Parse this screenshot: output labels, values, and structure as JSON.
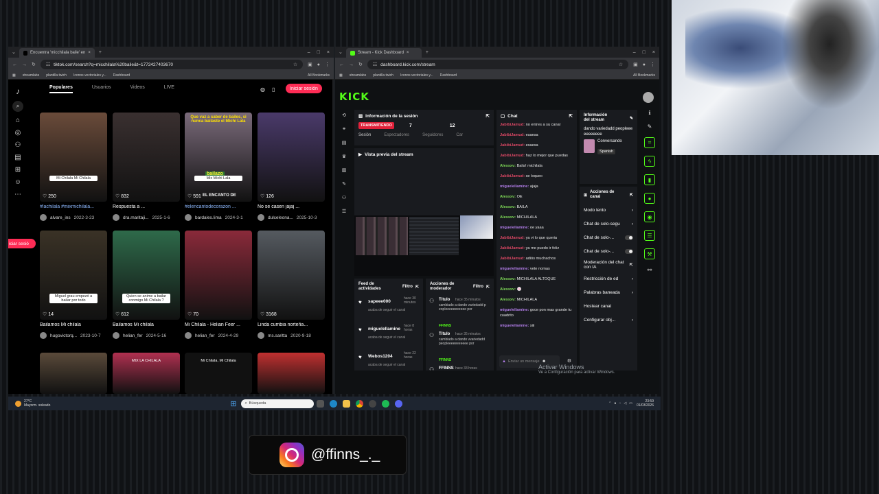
{
  "left_browser": {
    "tab_title": "Encuentra 'micchilala baile' en",
    "url": "tiktok.com/search?q=micchilala%20baile&t=1772427403670",
    "bookmarks": [
      "streamlabs",
      "plantilla twich",
      "Iconos vectoriales y...",
      "Dashboard"
    ],
    "all_bookmarks": "All Bookmarks"
  },
  "tiktok": {
    "tabs": [
      "Populares",
      "Usuarios",
      "Videos",
      "LIVE"
    ],
    "login_button": "Iniciar sesión",
    "side_login": "iciar sesió",
    "videos": [
      {
        "likes": "250",
        "overlay": "Mi Chilala Mi Chilala",
        "caption": "#lachilala #mixmichilala...",
        "user": "alvare_ins",
        "date": "2022-3-23",
        "color": "#6a4b3a"
      },
      {
        "likes": "832",
        "overlay": "",
        "caption": "Respuesta a ...",
        "user": "dra.maritaji...",
        "date": "2025-1-6",
        "color": "#3a3030"
      },
      {
        "likes": "591",
        "overlay": "Mix Michi Lala",
        "caption": "#elencantodecorazon ...",
        "user": "bardales.lima",
        "date": "2024-3-1",
        "color": "#7a6a7a",
        "top_text": "Que vaz a saber de bailes, si nunca bailaste el Michi Lala",
        "mid_text": "bailazo",
        "low_text": "EL ENCANTO DE"
      },
      {
        "likes": "126",
        "overlay": "",
        "caption": "No se casen jajaj ...",
        "user": "dulceleona...",
        "date": "2025-10-3",
        "color": "#4a3a6a"
      },
      {
        "likes": "14",
        "overlay": "Miguel grau empezó a bailar por todo",
        "caption": "Bailamos Mi chilala",
        "user": "hugovictorq...",
        "date": "2023-10-7",
        "color": "#3a3226"
      },
      {
        "likes": "612",
        "overlay": "Quien se anime a bailar conmigo Mi Chilala ?",
        "caption": "Bailamos Mi chilala",
        "user": "helian_fer",
        "date": "2024-5-16",
        "color": "#2e6a4a"
      },
      {
        "likes": "70",
        "overlay": "",
        "caption": "Mi Chilala - Helian Feer ...",
        "user": "helian_fer",
        "date": "2024-4-29",
        "color": "#8a2a3a"
      },
      {
        "likes": "3168",
        "overlay": "",
        "caption": "Linda cumbia norteña...",
        "user": "ms.saritta",
        "date": "2020-9-18",
        "color": "#555a60"
      },
      {
        "likes": "",
        "overlay": "",
        "caption": "",
        "user": "",
        "date": "",
        "color": "#5a4a3a"
      },
      {
        "likes": "",
        "overlay": "MIX LA CHILALA",
        "caption": "",
        "user": "",
        "date": "",
        "color": "#b03050"
      },
      {
        "likes": "",
        "overlay": "Mi Chilala, Mi Chilala",
        "caption": "",
        "user": "",
        "date": "",
        "color": "#111"
      },
      {
        "likes": "",
        "overlay": "",
        "caption": "",
        "user": "",
        "date": "",
        "color": "#c03030"
      }
    ]
  },
  "right_browser": {
    "tab_title": "Stream - Kick Dashboard",
    "url": "dashboard.kick.com/stream",
    "bookmarks": [
      "streamlabs",
      "plantilla twich",
      "Iconos vectoriales y...",
      "Dashboard"
    ],
    "all_bookmarks": "All Bookmarks"
  },
  "kick": {
    "logo": "KICK",
    "session": {
      "title": "Información de la sesión",
      "status": "TRANSMITIENDO",
      "viewers": "7",
      "followers": "12",
      "labels": [
        "Sesión",
        "Espectadores",
        "Seguidores",
        "Car"
      ]
    },
    "preview_title": "Vista previa del stream",
    "chat_title": "Chat",
    "chat": [
      {
        "user": "JabibiJamud:",
        "cls": "u1",
        "msg": "no entres a su canal"
      },
      {
        "user": "JabibiJamud:",
        "cls": "u1",
        "msg": "esaesa"
      },
      {
        "user": "JabibiJamud:",
        "cls": "u1",
        "msg": "esaesa"
      },
      {
        "user": "JabibiJamud:",
        "cls": "u1",
        "msg": "haz lo mejor que puedas"
      },
      {
        "user": "Alessxv:",
        "cls": "u2",
        "msg": "Baila! michilala"
      },
      {
        "user": "JabibiJamud:",
        "cls": "u1",
        "msg": "se loqueo"
      },
      {
        "user": "miguelellamine:",
        "cls": "u3",
        "msg": "ajaja"
      },
      {
        "user": "Alessxv:",
        "cls": "u2",
        "msg": "OE"
      },
      {
        "user": "Alessxv:",
        "cls": "u2",
        "msg": "BAILA"
      },
      {
        "user": "Alessxv:",
        "cls": "u2",
        "msg": "MICHILALA"
      },
      {
        "user": "miguelellamine:",
        "cls": "u3",
        "msg": "oe yaaa"
      },
      {
        "user": "JabibiJamud:",
        "cls": "u1",
        "msg": "ya vi lo que queria"
      },
      {
        "user": "JabibiJamud:",
        "cls": "u1",
        "msg": "ya me puedo ir feliz"
      },
      {
        "user": "JabibiJamud:",
        "cls": "u1",
        "msg": "adiós muchachos"
      },
      {
        "user": "miguelellamine:",
        "cls": "u3",
        "msg": "vete nomas"
      },
      {
        "user": "Alessxv:",
        "cls": "u2",
        "msg": "MICHILALA ALTOQUE"
      },
      {
        "user": "Alessxv:",
        "cls": "u2",
        "msg": "🍥"
      },
      {
        "user": "Alessxv:",
        "cls": "u2",
        "msg": "MICHILALA"
      },
      {
        "user": "miguelellamine:",
        "cls": "u3",
        "msg": "goce pon mas grande tu cuadrito"
      },
      {
        "user": "miguelellamine:",
        "cls": "u3",
        "msg": "siii"
      }
    ],
    "chat_placeholder": "Enviar un mensaje",
    "stream_info": {
      "title": "Información del stream",
      "desc": "dando variedadd peopleeeeeeeeeee",
      "category": "Conversando",
      "language": "Spanish"
    },
    "channel_actions": {
      "title": "Acciones de canal",
      "items": [
        "Modo lento",
        "Chat de solo-segu",
        "Chat de solo-...",
        "Chat de solo-...",
        "Moderación del chat con IA",
        "Restricción de ed",
        "Palabras baneada",
        "Hostear canal",
        "Configurar obj..."
      ]
    },
    "feed": {
      "title": "Feed de actividades",
      "filter": "Filtro",
      "items": [
        {
          "user": "sapeee000",
          "time": "hace 30 minutos",
          "desc": "acaba de seguir el canal"
        },
        {
          "user": "miguelellamine",
          "time": "hace 8 horas",
          "desc": "acaba de seguir el canal"
        },
        {
          "user": "Webos1204",
          "time": "hace 22 horas",
          "desc": "acaba de seguir el canal"
        }
      ]
    },
    "mod_actions": {
      "title": "Acciones de moderador",
      "filter": "Filtro",
      "items": [
        {
          "label": "Título",
          "time": "hace 35 minutos",
          "desc": "cambiado a dando variedadd peopleeeeeeeeeee por",
          "by": "FFINNS"
        },
        {
          "label": "Título",
          "time": "hace 35 minutos",
          "desc": "cambiado a dando vvariedadd peopleeeeeeeeeee por",
          "by": "FFINNS"
        },
        {
          "label": "FFINNS",
          "time": "hace 33 horas",
          "desc": "",
          "by": ""
        }
      ]
    }
  },
  "windows": {
    "activate_title": "Activar Windows",
    "activate_sub": "Ve a Configuración para activar Windows."
  },
  "taskbar": {
    "temp": "27°C",
    "weather": "Mayorm. soleado",
    "search": "Búsqueda",
    "time": "23:59",
    "date": "01/03/2026"
  },
  "instagram": {
    "handle": "@ffinns_._"
  }
}
